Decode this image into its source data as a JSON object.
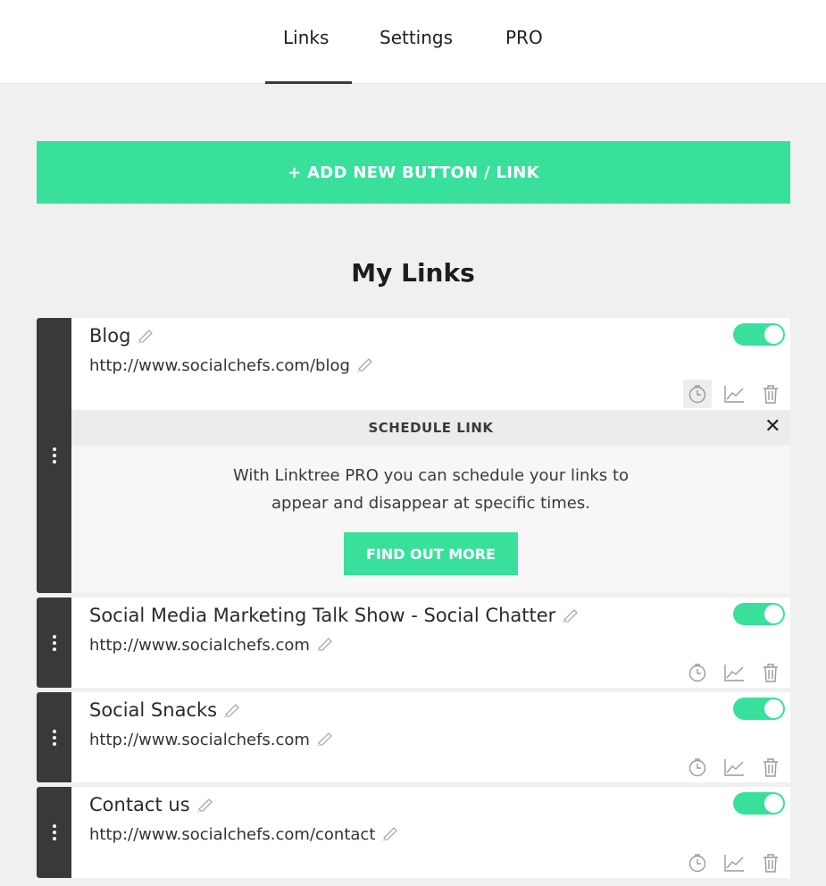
{
  "nav": {
    "tabs": [
      "Links",
      "Settings",
      "PRO"
    ],
    "active_tab": "Links"
  },
  "add_button_label": "+ ADD NEW BUTTON / LINK",
  "section_title": "My Links",
  "schedule_panel": {
    "title": "SCHEDULE LINK",
    "close_label": "✕",
    "text_line1": "With Linktree PRO you can schedule your links to",
    "text_line2": "appear and disappear at specific times.",
    "cta_label": "FIND OUT MORE"
  },
  "links": [
    {
      "title": "Blog",
      "url": "http://www.socialchefs.com/blog",
      "enabled": true
    },
    {
      "title": "Social Media Marketing Talk Show - Social Chatter",
      "url": "http://www.socialchefs.com",
      "enabled": true
    },
    {
      "title": "Social Snacks",
      "url": "http://www.socialchefs.com",
      "enabled": true
    },
    {
      "title": "Contact us",
      "url": "http://www.socialchefs.com/contact",
      "enabled": true
    }
  ],
  "colors": {
    "accent": "#39e09b",
    "handle": "#393939",
    "background": "#eff0ef"
  },
  "icons": [
    "pencil-icon",
    "clock-icon",
    "analytics-icon",
    "trash-icon",
    "drag-handle-icon"
  ]
}
